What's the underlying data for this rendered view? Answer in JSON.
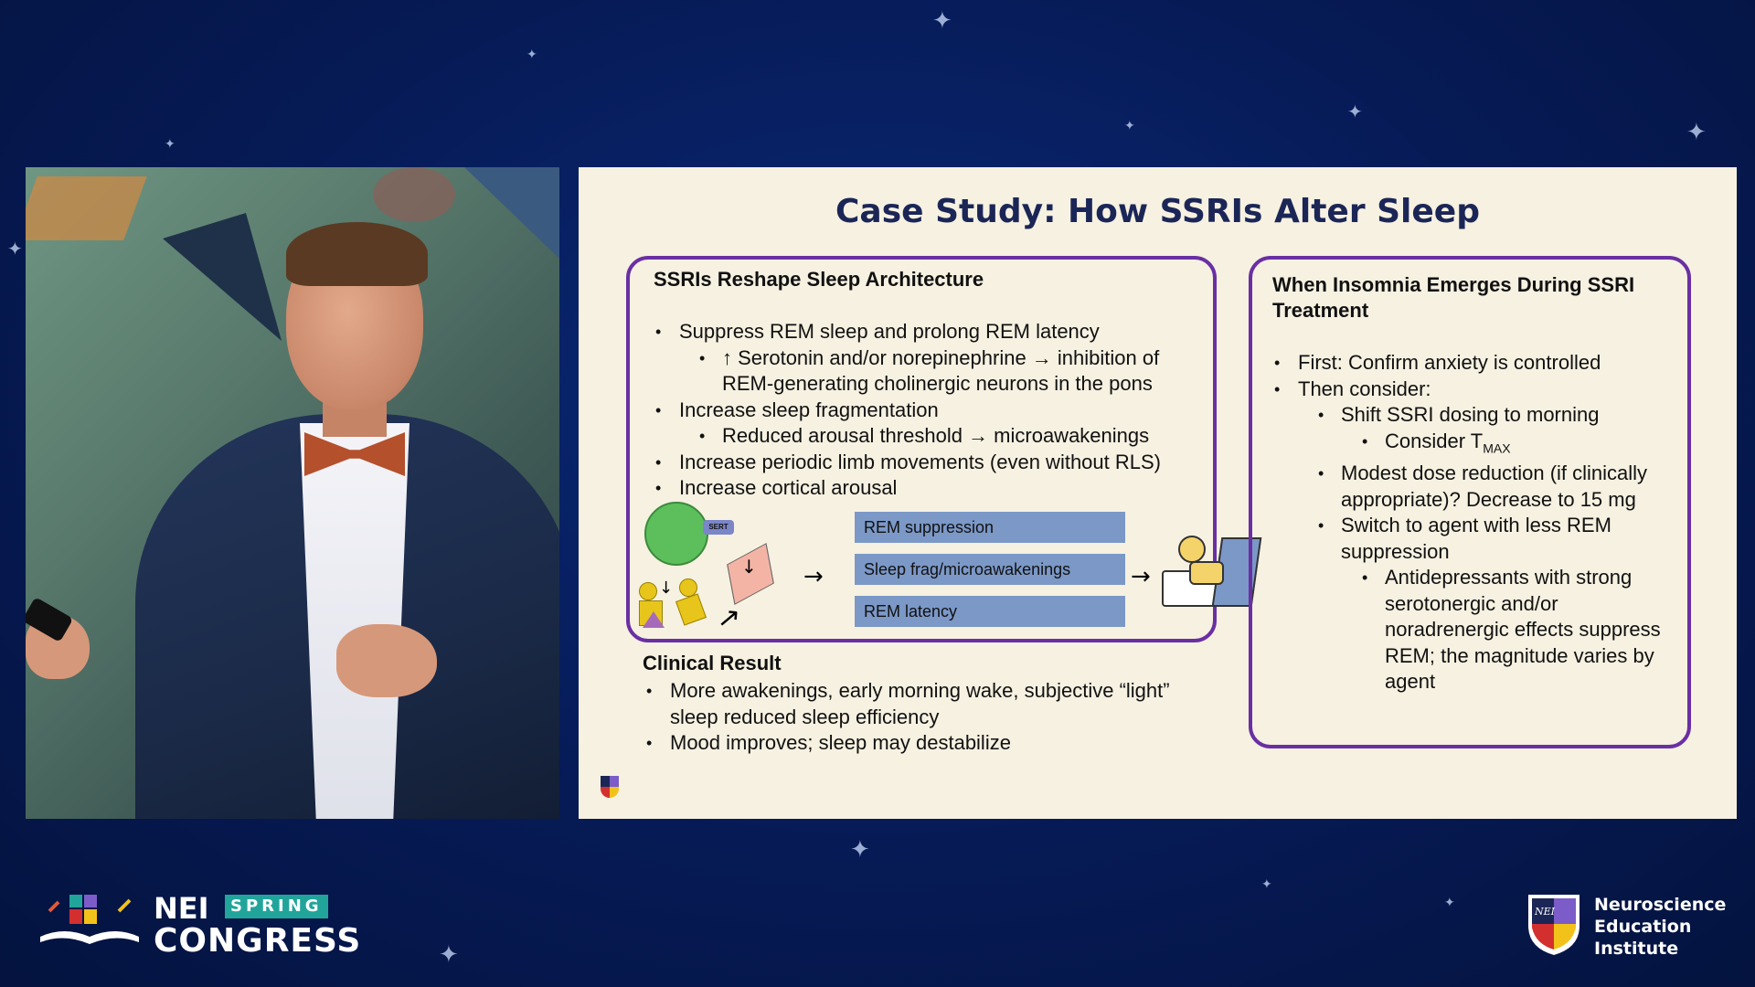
{
  "slide": {
    "title": "Case Study: How SSRIs Alter Sleep",
    "left_box": {
      "heading": "SSRIs Reshape Sleep Architecture",
      "bullets": [
        "Suppress REM sleep and prolong REM latency",
        "↑ Serotonin and/or norepinephrine → inhibition of REM-generating cholinergic neurons in the pons",
        "Increase sleep fragmentation",
        "Reduced arousal threshold → microawakenings",
        "Increase periodic limb movements (even without RLS)",
        "Increase cortical arousal"
      ],
      "diagram": {
        "sert_label": "SERT",
        "bars": [
          "REM suppression",
          "Sleep frag/microawakenings",
          "REM latency"
        ]
      }
    },
    "clinical": {
      "heading": "Clinical Result",
      "bullets": [
        "More awakenings, early morning wake, subjective “light” sleep reduced sleep efficiency",
        "Mood improves; sleep may destabilize"
      ]
    },
    "right_box": {
      "heading": "When Insomnia Emerges During SSRI Treatment",
      "bullets": [
        "First: Confirm anxiety is controlled",
        "Then consider:",
        "Shift SSRI dosing to morning",
        "Consider T",
        "MAX",
        "Modest dose reduction (if clinically appropriate)? Decrease to 15 mg",
        "Switch to agent with less REM suppression",
        "Antidepressants with strong serotonergic and/or noradrenergic effects suppress REM; the magnitude varies by agent"
      ]
    }
  },
  "footer": {
    "event_abbr": "NEI",
    "event_season": "SPRING",
    "event_name": "CONGRESS",
    "logo_mark": "NEI",
    "institute_name": "Neuroscience Education Institute"
  },
  "colors": {
    "background": "#061a55",
    "slide_bg": "#f6f1e1",
    "title": "#1b2657",
    "box_border": "#6a2fa3",
    "bar_fill": "#7b98c7",
    "spring_badge": "#21a59b"
  }
}
